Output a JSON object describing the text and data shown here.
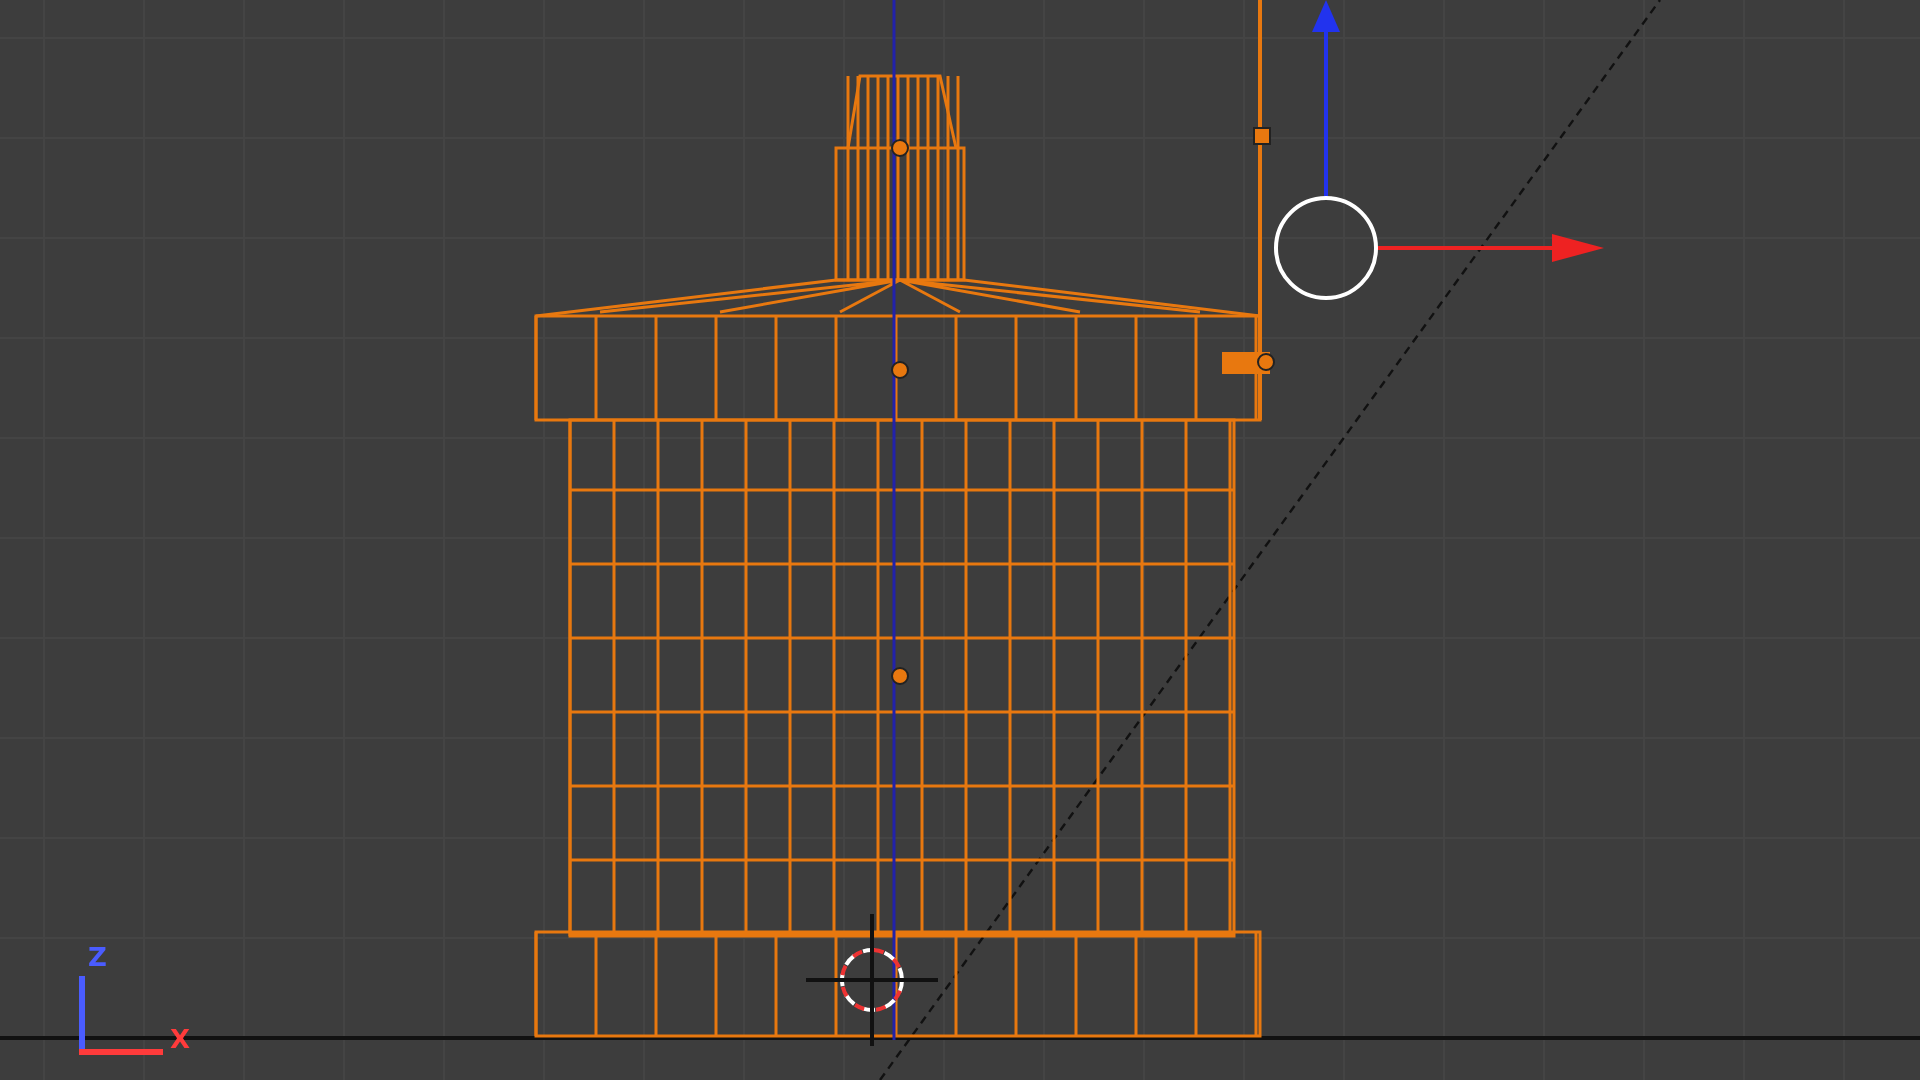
{
  "viewport": {
    "axes": [
      {
        "kind": "vertical",
        "label": "Z",
        "color": "#4a5cff"
      },
      {
        "kind": "horizontal",
        "label": "X",
        "color": "#ff3b3b"
      }
    ]
  }
}
